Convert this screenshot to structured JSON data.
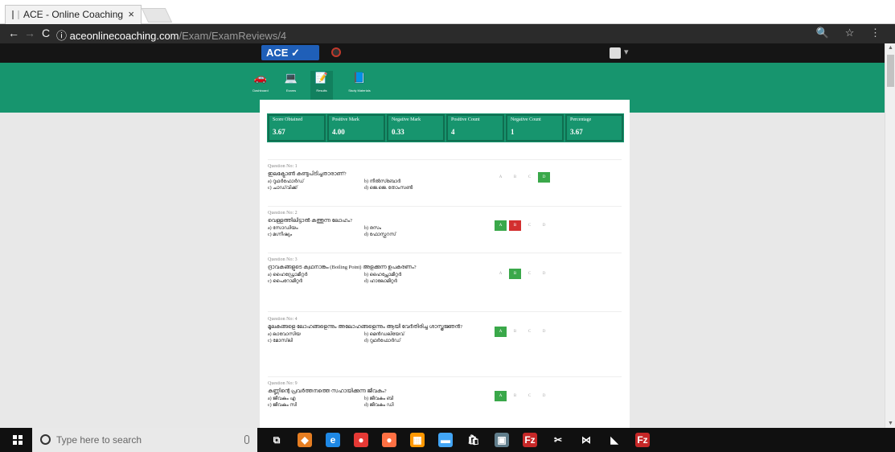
{
  "browser": {
    "tab_title": "ACE - Online Coaching",
    "tab_close": "×",
    "url_host": "aceonlinecoaching.com",
    "url_path": "/Exam/ExamReviews/4",
    "back": "←",
    "forward": "→",
    "reload": "C",
    "info": "ⓘ",
    "right_icons": "🔍 ☆ ⋮"
  },
  "site": {
    "logo_text": "ACE ✓",
    "menu": [
      {
        "label": "Dashboard",
        "icon": "dashboard-icon",
        "glyph": "🚗"
      },
      {
        "label": "Exams",
        "icon": "laptop-icon",
        "glyph": "💻"
      },
      {
        "label": "Results",
        "icon": "edit-icon",
        "glyph": "📝"
      },
      {
        "label": "Study Materials",
        "icon": "book-icon",
        "glyph": "📘"
      }
    ],
    "user_caret": "▾"
  },
  "stats": [
    {
      "label": "Score Obtained",
      "value": "3.67"
    },
    {
      "label": "Positive Mark",
      "value": "4.00"
    },
    {
      "label": "Negative Mark",
      "value": "0.33"
    },
    {
      "label": "Positive Count",
      "value": "4"
    },
    {
      "label": "Negative Count",
      "value": "1"
    },
    {
      "label": "Percentage",
      "value": "3.67"
    }
  ],
  "questions": [
    {
      "no": "Question No: 1",
      "text": "ഇലക്ട്രോൺ കണ്ടുപിടിച്ചതാരാണ്?",
      "opts": [
        "a) റുഥർഫോർഡ്",
        "b) നീൽസ്ബോർ",
        "c) ചാഡ്‌വിക്ക്",
        "d) ജെ.ജെ. തോംസൺ"
      ],
      "answers": [
        {
          "l": "A",
          "s": ""
        },
        {
          "l": "B",
          "s": ""
        },
        {
          "l": "C",
          "s": ""
        },
        {
          "l": "D",
          "s": "correct"
        }
      ]
    },
    {
      "no": "Question No: 2",
      "text": "വെള്ളത്തിലിട്ടാൽ കത്തുന്ന ലോഹം?",
      "opts": [
        "a) സോഡിയം",
        "b) രസം",
        "c) മഗ്നീഷ്യം",
        "d) ഫോസ്ഫറസ്"
      ],
      "answers": [
        {
          "l": "A",
          "s": "correct"
        },
        {
          "l": "B",
          "s": "wrong"
        },
        {
          "l": "C",
          "s": ""
        },
        {
          "l": "D",
          "s": ""
        }
      ]
    },
    {
      "no": "Question No: 3",
      "text": "ദ്രാവകങ്ങളുടെ ക്വഥനാങ്കം (Boiling Point) അളക്കുന്ന ഉപകരണം?",
      "opts": [
        "a) ഹൈഡ്രോമീറ്റർ",
        "b) ഹൈപ്സോമീറ്റർ",
        "c) പൈറോമീറ്റർ",
        "d) ഹാലോമീറ്റർ"
      ],
      "answers": [
        {
          "l": "A",
          "s": ""
        },
        {
          "l": "B",
          "s": "correct"
        },
        {
          "l": "C",
          "s": ""
        },
        {
          "l": "D",
          "s": ""
        }
      ]
    },
    {
      "no": "Question No: 4",
      "text": "മൂലകങ്ങളെ ലോഹങ്ങളെന്നും അലോഹങ്ങളെന്നും ആയി വേർതിരിച്ച ശാസ്ത്രജ്ഞൻ?",
      "opts": [
        "a) ലാവോസിയ",
        "b) മെൻഡലിയേവ്",
        "c) മോസ്‌ലി",
        "d) റുഥർഫോർഡ്"
      ],
      "answers": [
        {
          "l": "A",
          "s": "correct"
        },
        {
          "l": "B",
          "s": ""
        },
        {
          "l": "C",
          "s": ""
        },
        {
          "l": "D",
          "s": ""
        }
      ]
    },
    {
      "no": "Question No: 9",
      "text": "കണ്ണിന്റെ പ്രവർത്തനത്തെ സഹായിക്കുന്ന ജീവകം?",
      "opts": [
        "a) ജീവകം എ",
        "b) ജീവകം ബി",
        "c) ജീവകം സി",
        "d) ജീവകം ഡി"
      ],
      "answers": [
        {
          "l": "A",
          "s": "correct"
        },
        {
          "l": "B",
          "s": ""
        },
        {
          "l": "C",
          "s": ""
        },
        {
          "l": "D",
          "s": ""
        }
      ]
    }
  ],
  "taskbar": {
    "search_placeholder": "Type here to search",
    "apps": [
      {
        "name": "task-view-icon",
        "glyph": "⧉",
        "color": "#101010"
      },
      {
        "name": "app-orange-icon",
        "glyph": "◆",
        "color": "#e67e22"
      },
      {
        "name": "edge-icon",
        "glyph": "e",
        "color": "#1e88e5"
      },
      {
        "name": "chrome-icon",
        "glyph": "●",
        "color": "#e53935"
      },
      {
        "name": "firefox-icon",
        "glyph": "●",
        "color": "#ff7043"
      },
      {
        "name": "paint-icon",
        "glyph": "▦",
        "color": "#ff9800"
      },
      {
        "name": "explorer-icon",
        "glyph": "▬",
        "color": "#42a5f5"
      },
      {
        "name": "store-icon",
        "glyph": "🛍",
        "color": "#101010"
      },
      {
        "name": "monitor-icon",
        "glyph": "▣",
        "color": "#607d8b"
      },
      {
        "name": "filezilla-icon",
        "glyph": "Fz",
        "color": "#c62828"
      },
      {
        "name": "snipping-icon",
        "glyph": "✂",
        "color": "#101010"
      },
      {
        "name": "vs-code-icon",
        "glyph": "⋈",
        "color": "#101010"
      },
      {
        "name": "visual-studio-icon",
        "glyph": "◣",
        "color": "#101010"
      },
      {
        "name": "filezilla2-icon",
        "glyph": "Fz",
        "color": "#c62828"
      }
    ]
  }
}
